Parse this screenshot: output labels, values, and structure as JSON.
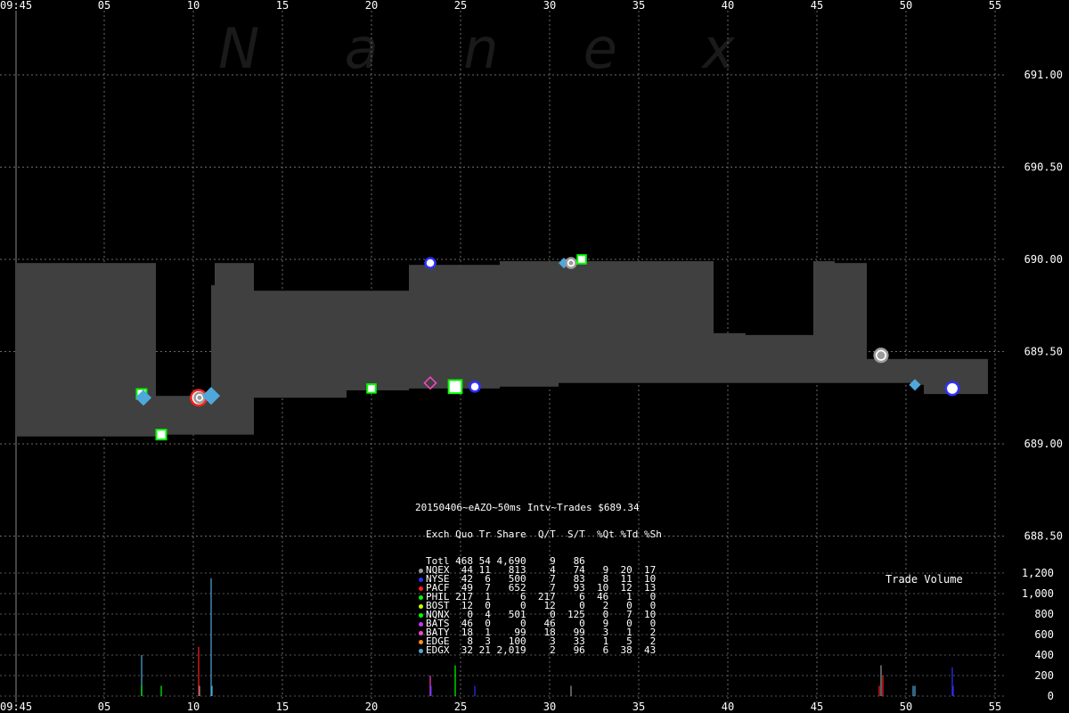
{
  "watermark": "Nanex",
  "chart_data": {
    "type": "line",
    "title": "20150406~eAZO~50ms Intv~Trades $689.34",
    "x_axis": {
      "start_label": "09:45",
      "tick_labels": [
        "05",
        "10",
        "15",
        "20",
        "25",
        "30",
        "35",
        "40",
        "45",
        "50",
        "55"
      ]
    },
    "y_axis_price": {
      "ticks": [
        691.0,
        690.5,
        690.0,
        689.5,
        689.0,
        688.5
      ],
      "tick_labels": [
        "691.00",
        "690.50",
        "690.00",
        "689.50",
        "689.00",
        "688.50"
      ],
      "range": [
        688.4,
        691.4
      ]
    },
    "y_axis_volume": {
      "label": "Trade Volume",
      "ticks": [
        0,
        200,
        400,
        600,
        800,
        1000,
        1200
      ],
      "tick_labels": [
        "0",
        "200",
        "400",
        "600",
        "800",
        "1,000",
        "1,200"
      ]
    },
    "quote_band": [
      {
        "t": 0,
        "bid": 689.04,
        "ask": 689.98
      },
      {
        "t": 0.7,
        "bid": 689.04,
        "ask": 689.98
      },
      {
        "t": 7.1,
        "bid": 689.04,
        "ask": 689.98
      },
      {
        "t": 7.9,
        "bid": 689.05,
        "ask": 689.26
      },
      {
        "t": 10.9,
        "bid": 689.05,
        "ask": 689.26
      },
      {
        "t": 11.0,
        "bid": 689.05,
        "ask": 689.86
      },
      {
        "t": 11.2,
        "bid": 689.05,
        "ask": 689.98
      },
      {
        "t": 13.4,
        "bid": 689.25,
        "ask": 689.83
      },
      {
        "t": 18.6,
        "bid": 689.29,
        "ask": 689.83
      },
      {
        "t": 22.1,
        "bid": 689.3,
        "ask": 689.97
      },
      {
        "t": 27.2,
        "bid": 689.31,
        "ask": 689.99
      },
      {
        "t": 30.5,
        "bid": 689.33,
        "ask": 689.99
      },
      {
        "t": 30.9,
        "bid": 689.33,
        "ask": 689.99
      },
      {
        "t": 31.1,
        "bid": 689.33,
        "ask": 689.99
      },
      {
        "t": 39.2,
        "bid": 689.33,
        "ask": 689.6
      },
      {
        "t": 41.0,
        "bid": 689.33,
        "ask": 689.59
      },
      {
        "t": 44.8,
        "bid": 689.33,
        "ask": 689.99
      },
      {
        "t": 46.0,
        "bid": 689.33,
        "ask": 689.98
      },
      {
        "t": 47.8,
        "bid": 689.33,
        "ask": 689.46
      },
      {
        "t": 50.6,
        "bid": 689.32,
        "ask": 689.46
      },
      {
        "t": 51.0,
        "bid": 689.3,
        "ask": 689.46
      },
      {
        "t": 51.0,
        "bid": 689.27,
        "ask": 689.46
      },
      {
        "t": 54.6,
        "bid": 689.27,
        "ask": 689.46
      }
    ],
    "trades": [
      {
        "t": 7.1,
        "price": 689.27,
        "exch": "NQNX",
        "size": 100
      },
      {
        "t": 7.2,
        "price": 689.25,
        "exch": "EDGX",
        "size": 400
      },
      {
        "t": 8.2,
        "price": 689.05,
        "exch": "NQNX",
        "size": 100
      },
      {
        "t": 10.3,
        "price": 689.25,
        "exch": "PACF",
        "size": 500
      },
      {
        "t": 10.35,
        "price": 689.25,
        "exch": "NQEX",
        "size": 100
      },
      {
        "t": 11.0,
        "price": 689.26,
        "exch": "EDGX",
        "size": 1150
      },
      {
        "t": 20.0,
        "price": 689.3,
        "exch": "NQNX",
        "size": 50
      },
      {
        "t": 23.3,
        "price": 689.98,
        "exch": "NYSE",
        "size": 100
      },
      {
        "t": 23.3,
        "price": 689.33,
        "exch": "BATY",
        "size": 200
      },
      {
        "t": 24.7,
        "price": 689.31,
        "exch": "NQNX",
        "size": 300
      },
      {
        "t": 25.8,
        "price": 689.31,
        "exch": "NYSE",
        "size": 100
      },
      {
        "t": 30.8,
        "price": 689.98,
        "exch": "EDGX",
        "size": 60
      },
      {
        "t": 31.2,
        "price": 689.98,
        "exch": "NQEX",
        "size": 100
      },
      {
        "t": 31.8,
        "price": 690.0,
        "exch": "NQNX",
        "size": 50
      },
      {
        "t": 48.6,
        "price": 689.48,
        "exch": "PACF",
        "size": 200
      },
      {
        "t": 48.6,
        "price": 689.48,
        "exch": "NQEX",
        "size": 300
      },
      {
        "t": 50.5,
        "price": 689.32,
        "exch": "EDGX",
        "size": 100
      },
      {
        "t": 52.6,
        "price": 689.3,
        "exch": "NYSE",
        "size": 280
      }
    ],
    "volume_bars": [
      {
        "t": 7.1,
        "v": 400,
        "color": "#4fa8dc"
      },
      {
        "t": 7.1,
        "v": 100,
        "color": "#00ff00"
      },
      {
        "t": 8.2,
        "v": 100,
        "color": "#00ff00"
      },
      {
        "t": 10.3,
        "v": 480,
        "color": "#ff2020"
      },
      {
        "t": 10.35,
        "v": 100,
        "color": "#9a9a9a"
      },
      {
        "t": 11.0,
        "v": 1150,
        "color": "#4fa8dc"
      },
      {
        "t": 11.05,
        "v": 100,
        "color": "#4fa8dc"
      },
      {
        "t": 23.3,
        "v": 200,
        "color": "#ff44cc"
      },
      {
        "t": 23.35,
        "v": 100,
        "color": "#3030ff"
      },
      {
        "t": 24.7,
        "v": 300,
        "color": "#00ff00"
      },
      {
        "t": 25.8,
        "v": 100,
        "color": "#3030ff"
      },
      {
        "t": 31.2,
        "v": 100,
        "color": "#9a9a9a"
      },
      {
        "t": 48.5,
        "v": 100,
        "color": "#ff2020"
      },
      {
        "t": 48.6,
        "v": 300,
        "color": "#9a9a9a"
      },
      {
        "t": 48.7,
        "v": 200,
        "color": "#ff2020"
      },
      {
        "t": 50.4,
        "v": 100,
        "color": "#4fa8dc"
      },
      {
        "t": 50.5,
        "v": 100,
        "color": "#4fa8dc"
      },
      {
        "t": 52.6,
        "v": 280,
        "color": "#3030ff"
      },
      {
        "t": 52.65,
        "v": 100,
        "color": "#3030ff"
      }
    ],
    "exchange_colors": {
      "NQEX": "#9a9a9a",
      "NYSE": "#3030ff",
      "PACF": "#ff2020",
      "PHIL": "#00ff00",
      "BOST": "#ccff00",
      "NQNX": "#00ff00",
      "BATS": "#cc33ff",
      "BATY": "#ff44cc",
      "EDGE": "#ff8c1a",
      "EDGX": "#4fa8dc"
    },
    "stats_table": {
      "title": "20150406~eAZO~50ms Intv~Trades $689.34",
      "header": "Exch Quo Tr Share  Q/T  S/T  %Qt %Td %Sh",
      "rows": [
        {
          "exch": "Totl",
          "text": "Totl 468 54 4,690    9   86",
          "color": ""
        },
        {
          "exch": "NQEX",
          "text": "NQEX  44 11   813    4   74   9  20  17",
          "color": "#9a9a9a"
        },
        {
          "exch": "NYSE",
          "text": "NYSE  42  6   500    7   83   8  11  10",
          "color": "#3030ff"
        },
        {
          "exch": "PACF",
          "text": "PACF  49  7   652    7   93  10  12  13",
          "color": "#ff2020"
        },
        {
          "exch": "PHIL",
          "text": "PHIL 217  1     6  217    6  46   1   0",
          "color": "#00ff00"
        },
        {
          "exch": "BOST",
          "text": "BOST  12  0     0   12    0   2   0   0",
          "color": "#ccff00"
        },
        {
          "exch": "NQNX",
          "text": "NQNX   0  4   501    0  125   0   7  10",
          "color": "#00ff00"
        },
        {
          "exch": "BATS",
          "text": "BATS  46  0     0   46    0   9   0   0",
          "color": "#cc33ff"
        },
        {
          "exch": "BATY",
          "text": "BATY  18  1    99   18   99   3   1   2",
          "color": "#ff44cc"
        },
        {
          "exch": "EDGE",
          "text": "EDGE   8  3   100    3   33   1   5   2",
          "color": "#ff8c1a"
        },
        {
          "exch": "EDGX",
          "text": "EDGX  32 21 2,019    2   96   6  38  43",
          "color": "#4fa8dc"
        }
      ]
    }
  }
}
